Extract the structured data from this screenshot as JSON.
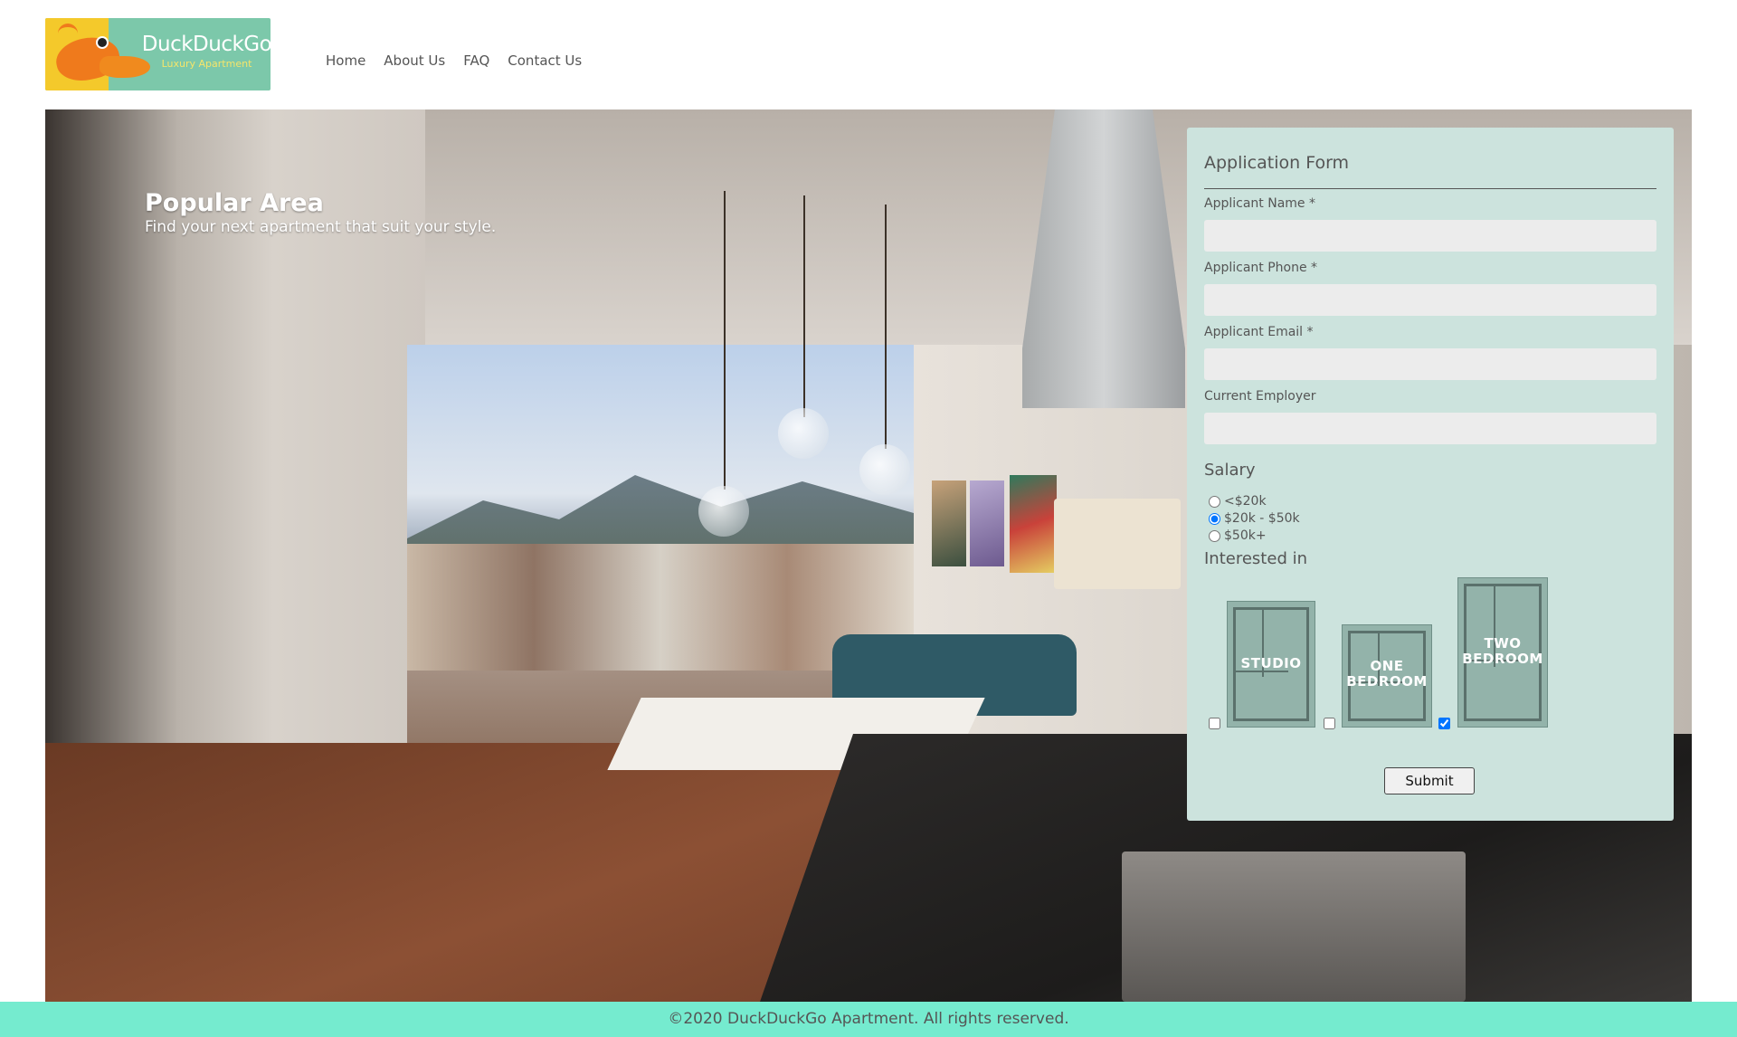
{
  "brand": {
    "name": "DuckDuckGo",
    "tagline": "Luxury Apartment"
  },
  "nav": {
    "items": [
      {
        "label": "Home"
      },
      {
        "label": "About Us"
      },
      {
        "label": "FAQ"
      },
      {
        "label": "Contact Us"
      }
    ]
  },
  "hero": {
    "title": "Popular Area",
    "subtitle": "Find your next apartment that suit your style."
  },
  "form": {
    "title": "Application Form",
    "fields": [
      {
        "label": "Applicant Name *",
        "value": "",
        "placeholder": ""
      },
      {
        "label": "Applicant Phone *",
        "value": "",
        "placeholder": ""
      },
      {
        "label": "Applicant Email *",
        "value": "",
        "placeholder": ""
      },
      {
        "label": "Current Employer",
        "value": "",
        "placeholder": ""
      }
    ],
    "salary": {
      "title": "Salary",
      "options": [
        {
          "label": "<$20k",
          "selected": false
        },
        {
          "label": "$20k - $50k",
          "selected": true
        },
        {
          "label": "$50k+",
          "selected": false
        }
      ]
    },
    "interest": {
      "title": "Interested in",
      "plans": [
        {
          "label_line1": "STUDIO",
          "label_line2": "",
          "checked": false
        },
        {
          "label_line1": "ONE",
          "label_line2": "BEDROOM",
          "checked": false
        },
        {
          "label_line1": "TWO",
          "label_line2": "BEDROOM",
          "checked": true
        }
      ]
    },
    "submit_label": "Submit"
  },
  "footer": {
    "text": "©2020 DuckDuckGo Apartment. All rights reserved."
  },
  "colors": {
    "form_background": "#cce3dd",
    "footer_background": "#75ebcf",
    "logo_background": "#7cc8aa",
    "logo_accent": "#f4c92b",
    "text": "#555555"
  }
}
